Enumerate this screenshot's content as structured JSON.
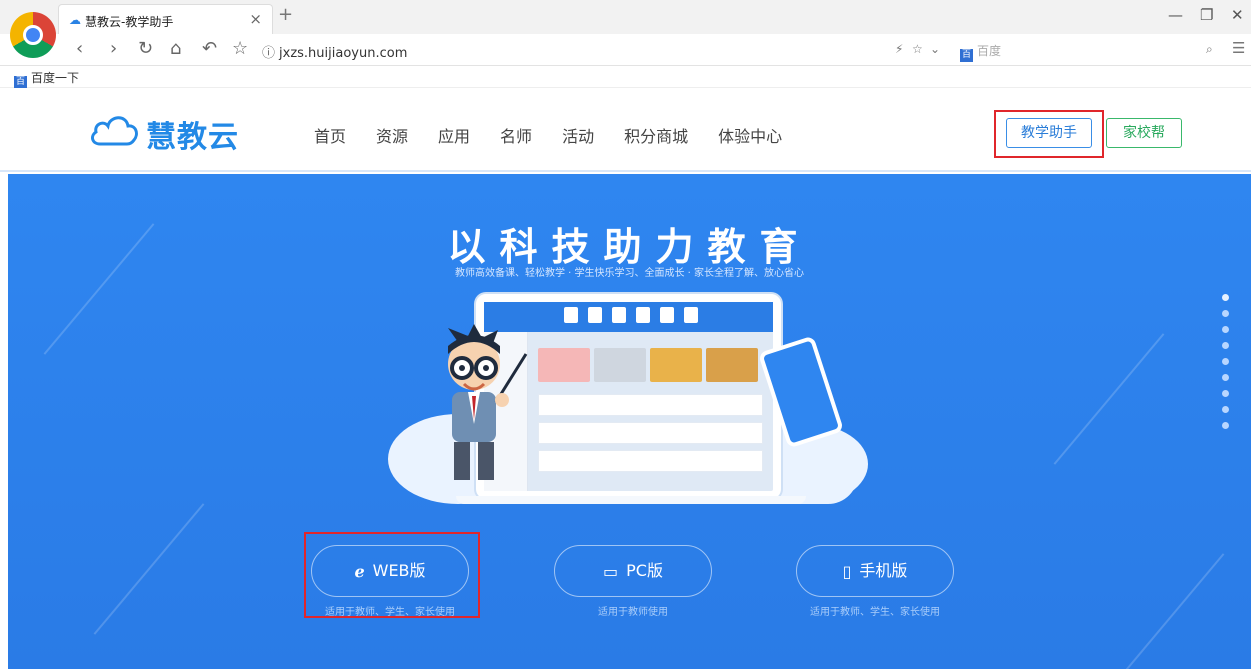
{
  "browser": {
    "tab_title": "慧教云-教学助手",
    "tab_close": "×",
    "new_tab": "+",
    "url": "jxzs.huijiaoyun.com",
    "url_info": "ⓘ",
    "search_placeholder": "百度",
    "search_engine_icon": "paw-icon",
    "bookmark_label": "百度一下",
    "win_min": "—",
    "win_restore": "❐",
    "win_close": "✕"
  },
  "site": {
    "brand": "慧教云",
    "nav": [
      "首页",
      "资源",
      "应用",
      "名师",
      "活动",
      "积分商城",
      "体验中心"
    ],
    "btn_teacher": "教学助手",
    "btn_parent": "家校帮"
  },
  "hero": {
    "slogan": "以科技助力教育",
    "subslogan": "教师高效备课、轻松教学 · 学生快乐学习、全面成长 · 家长全程了解、放心省心",
    "platforms": [
      {
        "label": "WEB版",
        "caption": "适用于教师、学生、家长使用",
        "icon": "ie-icon"
      },
      {
        "label": "PC版",
        "caption": "适用于教师使用",
        "icon": "monitor-icon"
      },
      {
        "label": "手机版",
        "caption": "适用于教师、学生、家长使用",
        "icon": "phone-icon"
      }
    ],
    "carousel_dots": 9,
    "active_dot": 0
  },
  "colors": {
    "hero_blue": "#2f86f0",
    "brand_blue": "#2389e6",
    "highlight_red": "#e0262b",
    "parent_green": "#39b86b"
  }
}
